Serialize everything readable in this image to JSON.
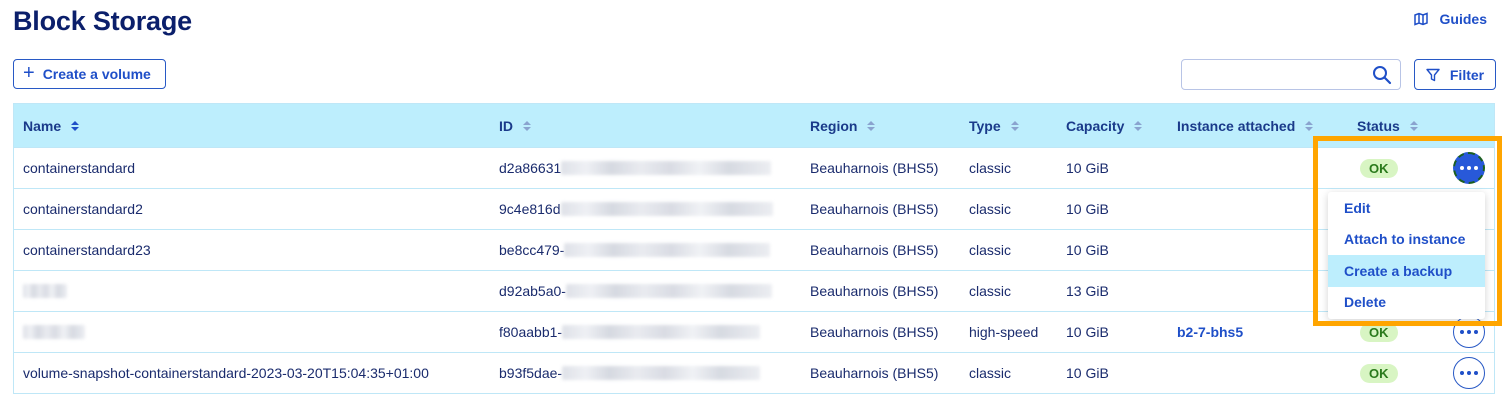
{
  "page": {
    "title": "Block Storage"
  },
  "header": {
    "guides_label": "Guides"
  },
  "toolbar": {
    "create_label": "Create a volume",
    "filter_label": "Filter",
    "search_value": ""
  },
  "table": {
    "columns": [
      "Name",
      "ID",
      "Region",
      "Type",
      "Capacity",
      "Instance attached",
      "Status"
    ],
    "rows": [
      {
        "name": "containerstandard",
        "id_prefix": "d2a86631",
        "region": "Beauharnois (BHS5)",
        "type": "classic",
        "capacity": "10 GiB",
        "instance": "",
        "status": "OK"
      },
      {
        "name": "containerstandard2",
        "id_prefix": "9c4e816d",
        "region": "Beauharnois (BHS5)",
        "type": "classic",
        "capacity": "10 GiB",
        "instance": "",
        "status": ""
      },
      {
        "name": "containerstandard23",
        "id_prefix": "be8cc479-",
        "region": "Beauharnois (BHS5)",
        "type": "classic",
        "capacity": "10 GiB",
        "instance": "",
        "status": ""
      },
      {
        "name": "",
        "id_prefix": "d92ab5a0-",
        "region": "Beauharnois (BHS5)",
        "type": "classic",
        "capacity": "13 GiB",
        "instance": "",
        "status": ""
      },
      {
        "name": "",
        "id_prefix": "f80aabb1-",
        "region": "Beauharnois (BHS5)",
        "type": "high-speed",
        "capacity": "10 GiB",
        "instance": "b2-7-bhs5",
        "status": "OK"
      },
      {
        "name": "volume-snapshot-containerstandard-2023-03-20T15:04:35+01:00",
        "id_prefix": "b93f5dae-",
        "region": "Beauharnois (BHS5)",
        "type": "classic",
        "capacity": "10 GiB",
        "instance": "",
        "status": "OK"
      }
    ]
  },
  "menu": {
    "items": [
      "Edit",
      "Attach to instance",
      "Create a backup",
      "Delete"
    ],
    "hovered": "Create a backup"
  },
  "colors": {
    "accent": "#1f4fc8",
    "header_bg": "#bdeefd",
    "status_ok_bg": "#d8f5c3",
    "highlight": "#ffa500"
  },
  "icons": {
    "guides": "map-book-icon",
    "create": "plus-icon",
    "search": "search-icon",
    "filter": "filter-icon",
    "actions": "more-dots-icon",
    "sort": "sort-arrows-icon"
  }
}
